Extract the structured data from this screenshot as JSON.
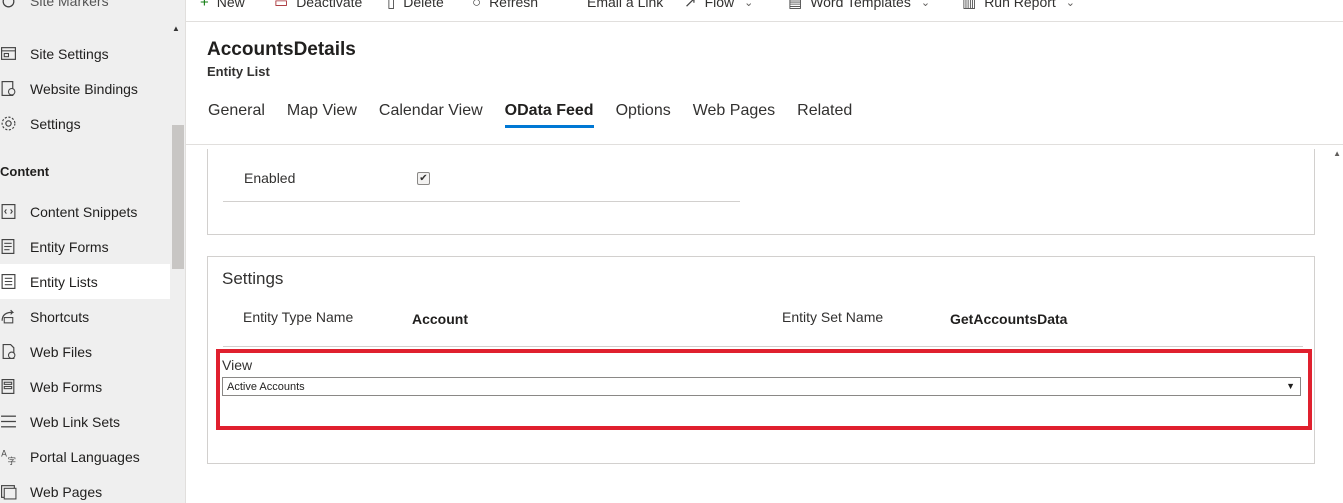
{
  "sidebar": {
    "cut_item": "Site Markers",
    "items_top": [
      {
        "label": "Site Settings",
        "icon": "site-settings-icon"
      },
      {
        "label": "Website Bindings",
        "icon": "website-bindings-icon"
      },
      {
        "label": "Settings",
        "icon": "gear-icon"
      }
    ],
    "section": "Content",
    "items": [
      {
        "label": "Content Snippets",
        "icon": "code-snippet-icon"
      },
      {
        "label": "Entity Forms",
        "icon": "form-icon"
      },
      {
        "label": "Entity Lists",
        "icon": "list-icon",
        "selected": true
      },
      {
        "label": "Shortcuts",
        "icon": "shortcut-icon"
      },
      {
        "label": "Web Files",
        "icon": "web-file-icon"
      },
      {
        "label": "Web Forms",
        "icon": "web-form-icon"
      },
      {
        "label": "Web Link Sets",
        "icon": "link-set-icon"
      },
      {
        "label": "Portal Languages",
        "icon": "language-icon"
      },
      {
        "label": "Web Pages",
        "icon": "web-page-icon"
      }
    ]
  },
  "commandbar": {
    "new": "New",
    "deactivate": "Deactivate",
    "delete": "Delete",
    "refresh": "Refresh",
    "email_link": "Email a Link",
    "flow": "Flow",
    "word_templates": "Word Templates",
    "run_report": "Run Report"
  },
  "header": {
    "title": "AccountsDetails",
    "subtitle": "Entity List",
    "tabs": [
      "General",
      "Map View",
      "Calendar View",
      "OData Feed",
      "Options",
      "Web Pages",
      "Related"
    ],
    "active_tab": "OData Feed"
  },
  "odata": {
    "enabled_label": "Enabled",
    "enabled_checked": true
  },
  "settings": {
    "title": "Settings",
    "entity_type_label": "Entity Type Name",
    "entity_type_value": "Account",
    "entity_set_label": "Entity Set Name",
    "entity_set_value": "GetAccountsData",
    "view_label": "View",
    "view_value": "Active Accounts"
  },
  "colors": {
    "accent": "#0078d4",
    "highlight": "#e0202e"
  }
}
